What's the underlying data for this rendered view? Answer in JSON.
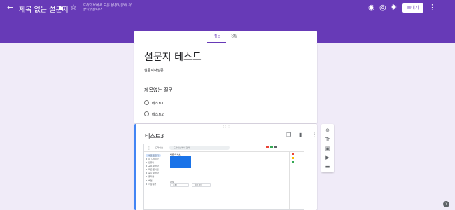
{
  "header": {
    "back_icon": "←",
    "title": "제목 없는 설문지",
    "folder_icon": "■",
    "star_icon": "☆",
    "save_note": "드라이브에서 모든 변경사항이 저장되었습니다",
    "palette_icon": "◉",
    "preview_icon": "◎",
    "settings_icon": "✹",
    "send_label": "보내기",
    "more_icon": "⋮"
  },
  "tabs": [
    {
      "label": "질문",
      "active": true
    },
    {
      "label": "응답",
      "active": false
    }
  ],
  "form": {
    "title": "설문지 테스트",
    "description": "설문지작성중"
  },
  "question1": {
    "title": "제목없는 질문",
    "options": [
      "테스트1",
      "테스트2"
    ]
  },
  "question2": {
    "drag_handle": "∷∷",
    "title": "테스트3",
    "copy_icon": "❐",
    "delete_icon": "▮",
    "more_icon": "⋮"
  },
  "side_tools": {
    "add_icon": "⊕",
    "title_icon": "Tr",
    "image_icon": "▣",
    "video_icon": "▶",
    "section_icon": "▬"
  },
  "embedded_screenshot": {
    "menu_icon": "⋮",
    "logo": "드라이브",
    "search_placeholder": "드라이브에서 검색",
    "sidebar_items": [
      "새로 만들기",
      "내 드라이브",
      "컴퓨터",
      "공유 문서함",
      "최근 문서함",
      "중요 문서함",
      "휴지통",
      "백업",
      "저장용량"
    ],
    "quick_access_label": "빠른 액세스",
    "files_label": "파일",
    "file_chips": [
      "새 폴더",
      "테스트 폴더"
    ],
    "highlight_colors": [
      "#ea4335",
      "#fbbc04",
      "#34a853"
    ]
  },
  "help_icon": "?"
}
